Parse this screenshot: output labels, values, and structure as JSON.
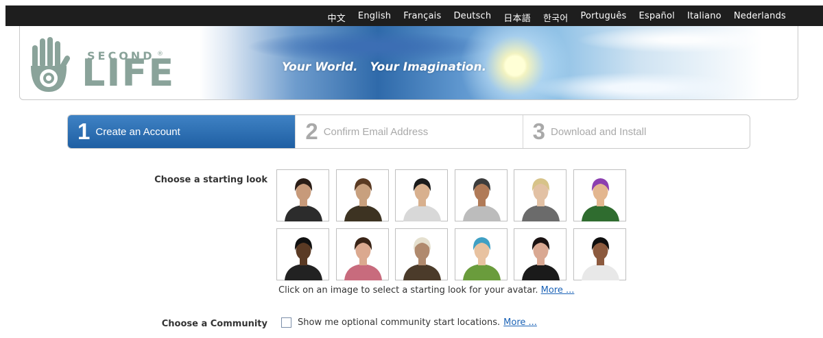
{
  "languages": [
    "中文",
    "English",
    "Français",
    "Deutsch",
    "日本語",
    "한국어",
    "Português",
    "Español",
    "Italiano",
    "Nederlands"
  ],
  "header": {
    "logo_second": "SECOND",
    "logo_life": "LIFE",
    "logo_reg": "®",
    "tagline_1": "Your World.",
    "tagline_2": "Your Imagination."
  },
  "steps": [
    {
      "number": "1",
      "label": "Create an Account",
      "state": "active"
    },
    {
      "number": "2",
      "label": "Confirm Email Address",
      "state": "inactive"
    },
    {
      "number": "3",
      "label": "Download and Install",
      "state": "inactive"
    }
  ],
  "look": {
    "heading": "Choose a starting look",
    "hint": "Click on an image to select a starting look for your avatar.",
    "more": "More ..."
  },
  "avatars": [
    {
      "name": "avatar-1",
      "hair": "#2a1d16",
      "skin": "#c79a7a",
      "shirt": "#2c2c2c"
    },
    {
      "name": "avatar-2",
      "hair": "#5a3a22",
      "skin": "#c8a07e",
      "shirt": "#3d3322"
    },
    {
      "name": "avatar-3",
      "hair": "#1b1b1b",
      "skin": "#d8b08e",
      "shirt": "#d8d8d8"
    },
    {
      "name": "avatar-4",
      "hair": "#3c3c3c",
      "skin": "#b07a57",
      "shirt": "#bcbcbc"
    },
    {
      "name": "avatar-5",
      "hair": "#d7c389",
      "skin": "#e2c1a4",
      "shirt": "#6b6b6b"
    },
    {
      "name": "avatar-6",
      "hair": "#8c3fb0",
      "skin": "#e3b68f",
      "shirt": "#2f6c2f"
    },
    {
      "name": "avatar-7",
      "hair": "#111111",
      "skin": "#5a3a24",
      "shirt": "#222222"
    },
    {
      "name": "avatar-8",
      "hair": "#3a2416",
      "skin": "#dba98f",
      "shirt": "#c86b7d"
    },
    {
      "name": "avatar-9",
      "hair": "#e5e0cf",
      "skin": "#b08a6e",
      "shirt": "#4b3b2a"
    },
    {
      "name": "avatar-10",
      "hair": "#3fa0c4",
      "skin": "#e8c2a0",
      "shirt": "#6a9c3c"
    },
    {
      "name": "avatar-11",
      "hair": "#1a1212",
      "skin": "#d9a892",
      "shirt": "#1a1a1a"
    },
    {
      "name": "avatar-12",
      "hair": "#0f0f0f",
      "skin": "#8c5a3e",
      "shirt": "#e8e8e8"
    }
  ],
  "community": {
    "heading": "Choose a Community",
    "checkbox_label": "Show me optional community start locations.",
    "more": "More ...",
    "checked": false
  },
  "colors": {
    "active_step": "#2c6fb2",
    "link": "#1a62b6",
    "logo": "#8aa39a"
  }
}
